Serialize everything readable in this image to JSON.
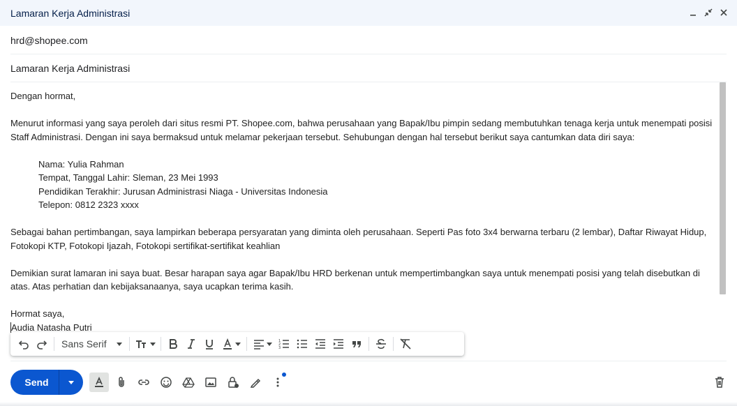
{
  "window": {
    "title": "Lamaran Kerja Administrasi",
    "controls": [
      "minimize-icon",
      "expand-icon",
      "close-icon"
    ]
  },
  "to": {
    "value": "hrd@shopee.com"
  },
  "subject": {
    "value": "Lamaran Kerja Administrasi"
  },
  "body": {
    "greeting": "Dengan hormat,",
    "para1": "Menurut informasi yang saya peroleh dari situs resmi PT. Shopee.com, bahwa perusahaan yang Bapak/Ibu pimpin sedang membutuhkan tenaga kerja untuk menempati posisi Staff Administrasi. Dengan ini saya bermaksud untuk melamar pekerjaan tersebut. Sehubungan dengan hal tersebut berikut saya cantumkan data diri saya:",
    "details": [
      "Nama: Yulia Rahman",
      "Tempat, Tanggal Lahir: Sleman, 23 Mei 1993",
      "Pendidikan Terakhir: Jurusan Administrasi Niaga - Universitas Indonesia",
      "Telepon: 0812 2323 xxxx"
    ],
    "para2": "Sebagai bahan pertimbangan, saya lampirkan beberapa persyaratan yang diminta oleh perusahaan. Seperti Pas foto 3x4 berwarna terbaru (2 lembar), Daftar Riwayat Hidup, Fotokopi KTP, Fotokopi Ijazah, Fotokopi sertifikat-sertifikat keahlian",
    "para3": "Demikian surat lamaran ini saya buat. Besar harapan saya agar Bapak/Ibu HRD berkenan untuk mempertimbangkan saya untuk menempati posisi yang telah disebutkan di atas. Atas perhatian dan kebijaksanaanya, saya ucapkan terima kasih.",
    "closing": "Hormat saya,",
    "signature": "Audia Natasha Putri"
  },
  "formatting_toolbar": {
    "font": "Sans Serif",
    "icons": [
      "undo-icon",
      "redo-icon",
      "font-size-icon",
      "bold-icon",
      "italic-icon",
      "underline-icon",
      "text-color-icon",
      "align-icon",
      "numbered-list-icon",
      "bulleted-list-icon",
      "indent-less-icon",
      "indent-more-icon",
      "quote-icon",
      "strikethrough-icon",
      "remove-formatting-icon"
    ]
  },
  "send": {
    "label": "Send"
  },
  "bottom_toolbar": {
    "icons": [
      "formatting-options-icon",
      "attach-icon",
      "link-icon",
      "emoji-icon",
      "drive-icon",
      "photo-icon",
      "confidential-icon",
      "signature-icon",
      "more-options-icon",
      "trash-icon"
    ]
  },
  "colors": {
    "accent": "#0b57d0",
    "titlebar_bg": "#f2f6fc"
  }
}
